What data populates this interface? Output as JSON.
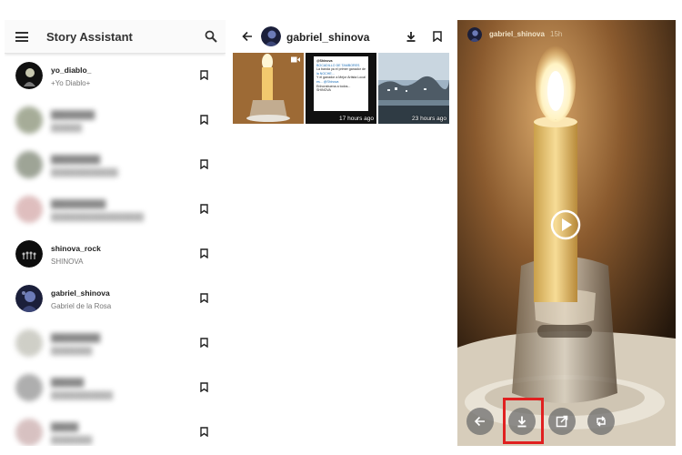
{
  "panel1": {
    "title": "Story Assistant",
    "accounts": [
      {
        "name": "yo_diablo_",
        "subtitle": "+Yo Diablo+",
        "blurred": false
      },
      {
        "name": "████████",
        "subtitle": "██████",
        "blurred": true
      },
      {
        "name": "█████████",
        "subtitle": "█████████████",
        "blurred": true
      },
      {
        "name": "██████████",
        "subtitle": "██████████████████",
        "blurred": true
      },
      {
        "name": "shinova_rock",
        "subtitle": "SHINOVA",
        "blurred": false
      },
      {
        "name": "gabriel_shinova",
        "subtitle": "Gabriel de la Rosa",
        "blurred": false
      },
      {
        "name": "█████████",
        "subtitle": "████████",
        "blurred": true
      },
      {
        "name": "██████",
        "subtitle": "████████████",
        "blurred": true
      },
      {
        "name": "█████",
        "subtitle": "████████",
        "blurred": true
      }
    ]
  },
  "panel2": {
    "username": "gabriel_shinova",
    "thumbs": [
      {
        "time": "",
        "kind": "video"
      },
      {
        "time": "17 hours ago",
        "kind": "image"
      },
      {
        "time": "23 hours ago",
        "kind": "image"
      }
    ],
    "tweet_lines": [
      "@Shinova",
      "BOCADILLO DE TAMBORES",
      "La banda ya el primer ganador de",
      "la NOCHE...",
      "Y el ganador a Mejor Artista Local",
      "es... @Shinova",
      "Enhorabuena a todos...",
      "SHINOVA"
    ]
  },
  "panel3": {
    "username": "gabriel_shinova",
    "age": "15h"
  },
  "icons": {
    "menu": "hamburger-icon",
    "search": "search-icon",
    "bookmark": "bookmark-icon",
    "back": "arrow-left-icon",
    "download": "download-icon",
    "play": "play-icon",
    "open": "open-external-icon",
    "repost": "repost-icon"
  },
  "colors": {
    "highlight": "#e02020",
    "flame": "#fff3c4"
  }
}
